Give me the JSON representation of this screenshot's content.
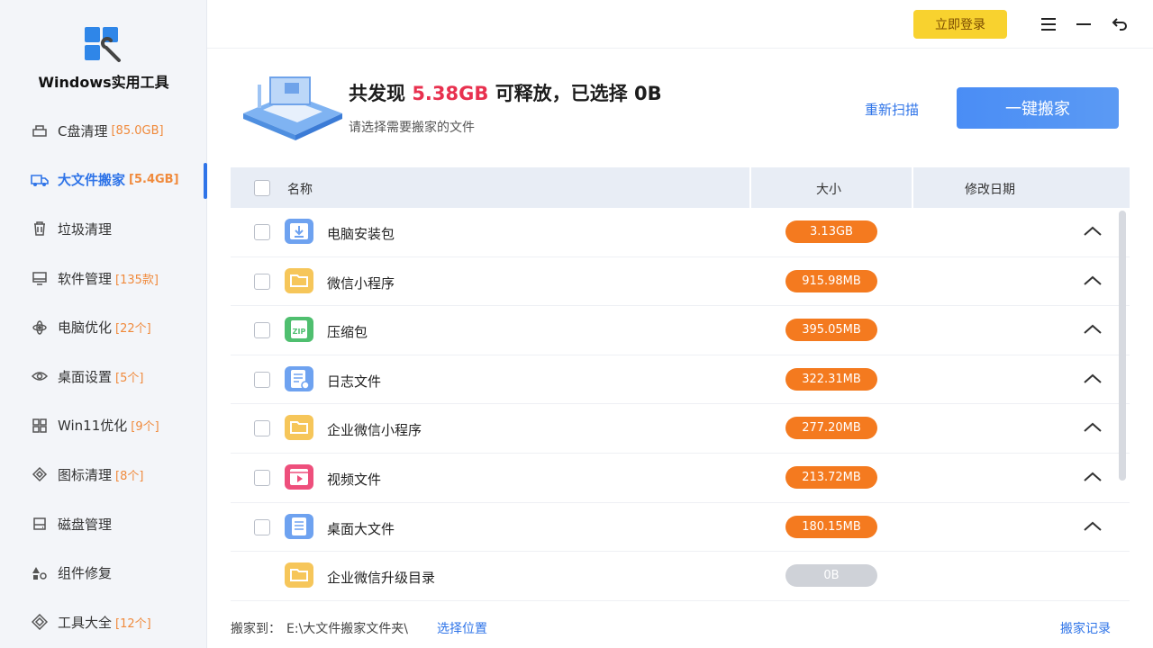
{
  "app": {
    "title": "Windows实用工具"
  },
  "topbar": {
    "login_label": "立即登录"
  },
  "sidebar": {
    "items": [
      {
        "label": "C盘清理",
        "badge": "[85.0GB]",
        "icon": "broom-icon"
      },
      {
        "label": "大文件搬家",
        "badge": "[5.4GB]",
        "icon": "truck-icon",
        "active": true
      },
      {
        "label": "垃圾清理",
        "badge": "",
        "icon": "trash-icon"
      },
      {
        "label": "软件管理",
        "badge": "[135款]",
        "icon": "monitor-icon"
      },
      {
        "label": "电脑优化",
        "badge": "[22个]",
        "icon": "atom-icon"
      },
      {
        "label": "桌面设置",
        "badge": "[5个]",
        "icon": "eye-icon"
      },
      {
        "label": "Win11优化",
        "badge": "[9个]",
        "icon": "grid-icon"
      },
      {
        "label": "图标清理",
        "badge": "[8个]",
        "icon": "tag-icon"
      },
      {
        "label": "磁盘管理",
        "badge": "",
        "icon": "disk-icon"
      },
      {
        "label": "组件修复",
        "badge": "",
        "icon": "shapes-icon"
      },
      {
        "label": "工具大全",
        "badge": "[12个]",
        "icon": "tools-icon"
      }
    ]
  },
  "summary": {
    "prefix": "共发现",
    "amount": "5.38GB",
    "middle": "可释放，已选择",
    "selected": "0B",
    "subtitle": "请选择需要搬家的文件",
    "rescan_label": "重新扫描",
    "move_label": "一键搬家"
  },
  "table": {
    "headers": {
      "name": "名称",
      "size": "大小",
      "date": "修改日期"
    },
    "rows": [
      {
        "name": "电脑安装包",
        "size": "3.13GB",
        "icon": "installer-icon",
        "color": "#6ea2f0",
        "checkbox": true
      },
      {
        "name": "微信小程序",
        "size": "915.98MB",
        "icon": "folder-icon",
        "color": "#f6c65a",
        "checkbox": true
      },
      {
        "name": "压缩包",
        "size": "395.05MB",
        "icon": "zip-icon",
        "color": "#4fbf6f",
        "checkbox": true
      },
      {
        "name": "日志文件",
        "size": "322.31MB",
        "icon": "log-file-icon",
        "color": "#6ea2f0",
        "checkbox": true
      },
      {
        "name": "企业微信小程序",
        "size": "277.20MB",
        "icon": "folder-icon",
        "color": "#f6c65a",
        "checkbox": true
      },
      {
        "name": "视频文件",
        "size": "213.72MB",
        "icon": "video-icon",
        "color": "#ee4f7c",
        "checkbox": true
      },
      {
        "name": "桌面大文件",
        "size": "180.15MB",
        "icon": "document-icon",
        "color": "#6ea2f0",
        "checkbox": true
      },
      {
        "name": "企业微信升级目录",
        "size": "0B",
        "icon": "folder-icon",
        "color": "#f6c65a",
        "checkbox": false
      }
    ]
  },
  "footer": {
    "label": "搬家到：",
    "path": "E:\\大文件搬家文件夹\\",
    "choose_label": "选择位置",
    "history_label": "搬家记录"
  }
}
